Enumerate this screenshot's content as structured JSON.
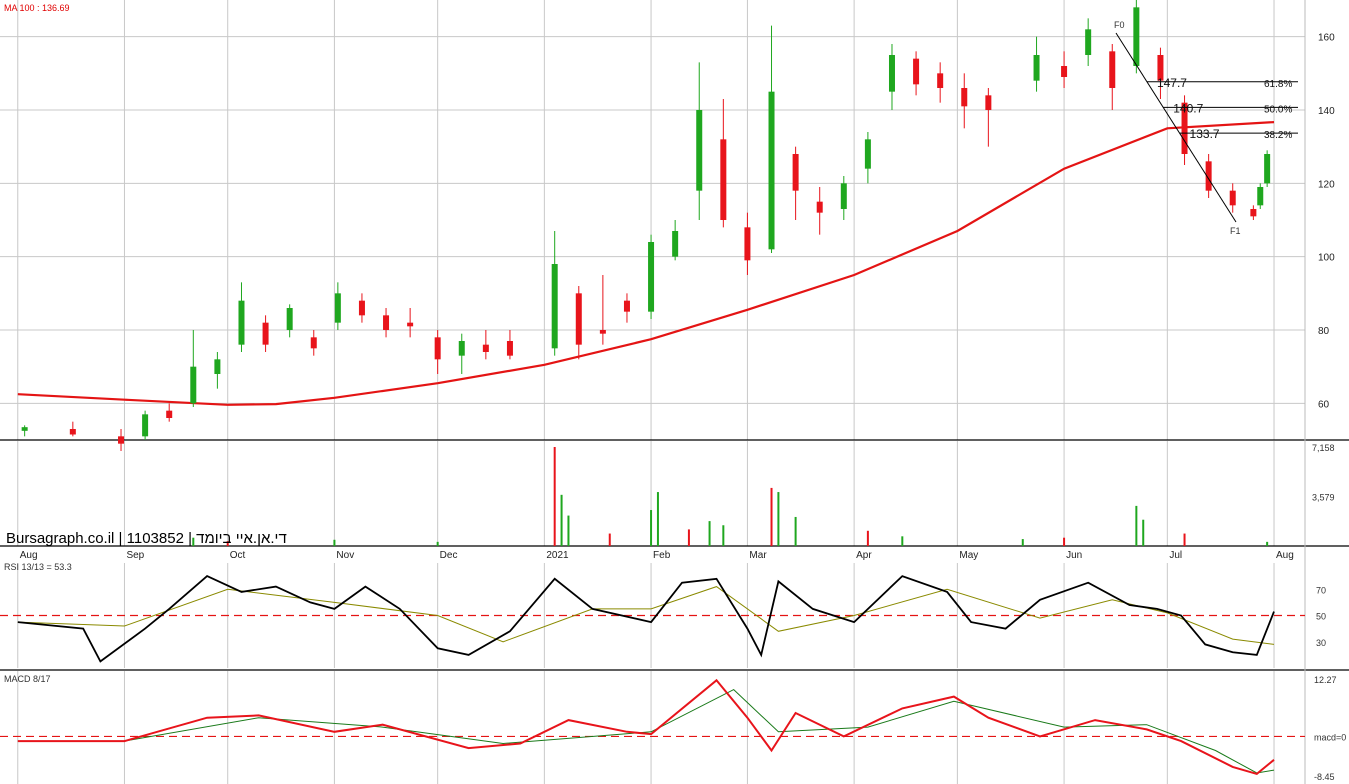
{
  "chart_data": {
    "type": "candlestick",
    "title": "",
    "watermark": "Bursagraph.co.il | 1103852 | די.אן.איי ביומד",
    "colors": {
      "up": "#1fa71f",
      "down": "#e8141b",
      "ma": "#e41414",
      "rsi": "#000000",
      "rsi_signal": "#8a8a00",
      "macd": "#e8141b",
      "macd_signal": "#1a7a1a"
    },
    "price_panel": {
      "ylim": [
        50,
        170
      ],
      "y_ticks": [
        60,
        80,
        100,
        120,
        140,
        160
      ],
      "ma_label": "MA 100 : 136.69",
      "ma_100": [
        {
          "x": "Aug 1",
          "y": 62.5
        },
        {
          "x": "Sep 1",
          "y": 61
        },
        {
          "x": "Oct 1",
          "y": 59.6
        },
        {
          "x": "Oct 15",
          "y": 59.8
        },
        {
          "x": "Nov 1",
          "y": 61.5
        },
        {
          "x": "Dec 1",
          "y": 65.5
        },
        {
          "x": "Jan 1",
          "y": 70.5
        },
        {
          "x": "Feb 1",
          "y": 77.5
        },
        {
          "x": "Mar 1",
          "y": 85.5
        },
        {
          "x": "Apr 1",
          "y": 95
        },
        {
          "x": "May 1",
          "y": 107
        },
        {
          "x": "Jun 1",
          "y": 124
        },
        {
          "x": "Jul 1",
          "y": 135
        },
        {
          "x": "Aug 1",
          "y": 136.7
        }
      ],
      "candles": [
        {
          "x": "Aug 3",
          "o": 52.5,
          "h": 54,
          "l": 51,
          "c": 53.5
        },
        {
          "x": "Aug 17",
          "o": 53,
          "h": 55,
          "l": 51,
          "c": 51.5
        },
        {
          "x": "Aug 31",
          "o": 51,
          "h": 53,
          "l": 47,
          "c": 49
        },
        {
          "x": "Sep 7",
          "o": 51,
          "h": 58,
          "l": 50,
          "c": 57
        },
        {
          "x": "Sep 14",
          "o": 58,
          "h": 60,
          "l": 55,
          "c": 56
        },
        {
          "x": "Sep 21",
          "o": 60,
          "h": 80,
          "l": 59,
          "c": 70
        },
        {
          "x": "Sep 28",
          "o": 68,
          "h": 74,
          "l": 64,
          "c": 72
        },
        {
          "x": "Oct 5",
          "o": 76,
          "h": 93,
          "l": 74,
          "c": 88
        },
        {
          "x": "Oct 12",
          "o": 82,
          "h": 84,
          "l": 74,
          "c": 76
        },
        {
          "x": "Oct 19",
          "o": 80,
          "h": 87,
          "l": 78,
          "c": 86
        },
        {
          "x": "Oct 26",
          "o": 78,
          "h": 80,
          "l": 73,
          "c": 75
        },
        {
          "x": "Nov 2",
          "o": 82,
          "h": 93,
          "l": 80,
          "c": 90
        },
        {
          "x": "Nov 9",
          "o": 88,
          "h": 90,
          "l": 82,
          "c": 84
        },
        {
          "x": "Nov 16",
          "o": 84,
          "h": 86,
          "l": 78,
          "c": 80
        },
        {
          "x": "Nov 23",
          "o": 82,
          "h": 86,
          "l": 78,
          "c": 81
        },
        {
          "x": "Dec 1",
          "o": 78,
          "h": 80,
          "l": 68,
          "c": 72
        },
        {
          "x": "Dec 8",
          "o": 73,
          "h": 79,
          "l": 68,
          "c": 77
        },
        {
          "x": "Dec 15",
          "o": 76,
          "h": 80,
          "l": 72,
          "c": 74
        },
        {
          "x": "Dec 22",
          "o": 77,
          "h": 80,
          "l": 72,
          "c": 73
        },
        {
          "x": "Jan 4",
          "o": 75,
          "h": 107,
          "l": 73,
          "c": 98
        },
        {
          "x": "Jan 11",
          "o": 90,
          "h": 92,
          "l": 72,
          "c": 76
        },
        {
          "x": "Jan 18",
          "o": 80,
          "h": 95,
          "l": 76,
          "c": 79
        },
        {
          "x": "Jan 25",
          "o": 88,
          "h": 90,
          "l": 82,
          "c": 85
        },
        {
          "x": "Feb 1",
          "o": 85,
          "h": 106,
          "l": 83,
          "c": 104
        },
        {
          "x": "Feb 8",
          "o": 100,
          "h": 110,
          "l": 99,
          "c": 107
        },
        {
          "x": "Feb 15",
          "o": 118,
          "h": 153,
          "l": 110,
          "c": 140
        },
        {
          "x": "Feb 22",
          "o": 132,
          "h": 143,
          "l": 108,
          "c": 110
        },
        {
          "x": "Mar 1",
          "o": 108,
          "h": 112,
          "l": 95,
          "c": 99
        },
        {
          "x": "Mar 8",
          "o": 102,
          "h": 163,
          "l": 101,
          "c": 145
        },
        {
          "x": "Mar 15",
          "o": 128,
          "h": 130,
          "l": 110,
          "c": 118
        },
        {
          "x": "Mar 22",
          "o": 115,
          "h": 119,
          "l": 106,
          "c": 112
        },
        {
          "x": "Mar 29",
          "o": 113,
          "h": 122,
          "l": 110,
          "c": 120
        },
        {
          "x": "Apr 5",
          "o": 124,
          "h": 134,
          "l": 120,
          "c": 132
        },
        {
          "x": "Apr 12",
          "o": 145,
          "h": 158,
          "l": 140,
          "c": 155
        },
        {
          "x": "Apr 19",
          "o": 154,
          "h": 156,
          "l": 144,
          "c": 147
        },
        {
          "x": "Apr 26",
          "o": 150,
          "h": 153,
          "l": 142,
          "c": 146
        },
        {
          "x": "May 3",
          "o": 146,
          "h": 150,
          "l": 135,
          "c": 141
        },
        {
          "x": "May 10",
          "o": 144,
          "h": 146,
          "l": 130,
          "c": 140
        },
        {
          "x": "May 24",
          "o": 148,
          "h": 160,
          "l": 145,
          "c": 155
        },
        {
          "x": "Jun 1",
          "o": 152,
          "h": 156,
          "l": 146,
          "c": 149
        },
        {
          "x": "Jun 8",
          "o": 155,
          "h": 165,
          "l": 152,
          "c": 162
        },
        {
          "x": "Jun 15",
          "o": 156,
          "h": 158,
          "l": 140,
          "c": 146
        },
        {
          "x": "Jun 22",
          "o": 152,
          "h": 170,
          "l": 150,
          "c": 168
        },
        {
          "x": "Jun 29",
          "o": 155,
          "h": 157,
          "l": 143,
          "c": 148
        },
        {
          "x": "Jul 6",
          "o": 142,
          "h": 144,
          "l": 125,
          "c": 128
        },
        {
          "x": "Jul 13",
          "o": 126,
          "h": 128,
          "l": 116,
          "c": 118
        },
        {
          "x": "Jul 20",
          "o": 118,
          "h": 120,
          "l": 112,
          "c": 114
        },
        {
          "x": "Jul 26",
          "o": 113,
          "h": 114,
          "l": 110,
          "c": 111
        },
        {
          "x": "Jul 28",
          "o": 114,
          "h": 120,
          "l": 113,
          "c": 119
        },
        {
          "x": "Jul 30",
          "o": 120,
          "h": 129,
          "l": 119,
          "c": 128
        }
      ],
      "fibonacci": {
        "start_label": "F0",
        "end_label": "F1",
        "levels": [
          {
            "value": "147.7",
            "pct": "61.8%"
          },
          {
            "value": "140.7",
            "pct": "50.0%"
          },
          {
            "value": "133.7",
            "pct": "38.2%"
          }
        ]
      }
    },
    "volume_panel": {
      "y_ticks": [
        "7,158",
        "3,579"
      ],
      "ymax": 7158,
      "bars": [
        {
          "x": "Sep 21",
          "v": 600
        },
        {
          "x": "Oct 1",
          "v": 350
        },
        {
          "x": "Nov 1",
          "v": 450
        },
        {
          "x": "Dec 1",
          "v": 300
        },
        {
          "x": "Jan 4",
          "v": 7158
        },
        {
          "x": "Jan 6",
          "v": 3700
        },
        {
          "x": "Jan 8",
          "v": 2200
        },
        {
          "x": "Jan 20",
          "v": 900
        },
        {
          "x": "Feb 1",
          "v": 2600
        },
        {
          "x": "Feb 3",
          "v": 3900
        },
        {
          "x": "Feb 12",
          "v": 1200
        },
        {
          "x": "Feb 18",
          "v": 1800
        },
        {
          "x": "Feb 22",
          "v": 1500
        },
        {
          "x": "Mar 8",
          "v": 4200
        },
        {
          "x": "Mar 10",
          "v": 3900
        },
        {
          "x": "Mar 15",
          "v": 2100
        },
        {
          "x": "Apr 5",
          "v": 1100
        },
        {
          "x": "Apr 15",
          "v": 700
        },
        {
          "x": "May 20",
          "v": 500
        },
        {
          "x": "Jun 1",
          "v": 600
        },
        {
          "x": "Jun 22",
          "v": 2900
        },
        {
          "x": "Jun 24",
          "v": 1900
        },
        {
          "x": "Jul 6",
          "v": 900
        },
        {
          "x": "Jul 30",
          "v": 300
        }
      ]
    },
    "x_axis": {
      "labels": [
        "Aug",
        "Sep",
        "Oct",
        "Nov",
        "Dec",
        "2021",
        "Feb",
        "Mar",
        "Apr",
        "May",
        "Jun",
        "Jul",
        "Aug"
      ]
    },
    "rsi_panel": {
      "label": "RSI 13/13 = 53.3",
      "ylim": [
        10,
        90
      ],
      "y_ticks": [
        30,
        50,
        70
      ],
      "ref_line": 50,
      "rsi": [
        {
          "x": "Aug 1",
          "y": 45
        },
        {
          "x": "Aug 20",
          "y": 40
        },
        {
          "x": "Aug 25",
          "y": 15
        },
        {
          "x": "Sep 7",
          "y": 40
        },
        {
          "x": "Sep 14",
          "y": 55
        },
        {
          "x": "Sep 25",
          "y": 80
        },
        {
          "x": "Oct 5",
          "y": 68
        },
        {
          "x": "Oct 15",
          "y": 72
        },
        {
          "x": "Oct 25",
          "y": 60
        },
        {
          "x": "Nov 1",
          "y": 55
        },
        {
          "x": "Nov 10",
          "y": 72
        },
        {
          "x": "Nov 20",
          "y": 55
        },
        {
          "x": "Dec 1",
          "y": 25
        },
        {
          "x": "Dec 10",
          "y": 20
        },
        {
          "x": "Dec 22",
          "y": 38
        },
        {
          "x": "Jan 4",
          "y": 78
        },
        {
          "x": "Jan 15",
          "y": 55
        },
        {
          "x": "Feb 1",
          "y": 45
        },
        {
          "x": "Feb 10",
          "y": 75
        },
        {
          "x": "Feb 20",
          "y": 78
        },
        {
          "x": "Mar 1",
          "y": 40
        },
        {
          "x": "Mar 5",
          "y": 20
        },
        {
          "x": "Mar 10",
          "y": 76
        },
        {
          "x": "Mar 20",
          "y": 55
        },
        {
          "x": "Apr 1",
          "y": 45
        },
        {
          "x": "Apr 15",
          "y": 80
        },
        {
          "x": "Apr 28",
          "y": 68
        },
        {
          "x": "May 5",
          "y": 45
        },
        {
          "x": "May 15",
          "y": 40
        },
        {
          "x": "May 25",
          "y": 62
        },
        {
          "x": "Jun 8",
          "y": 75
        },
        {
          "x": "Jun 20",
          "y": 58
        },
        {
          "x": "Jun 28",
          "y": 55
        },
        {
          "x": "Jul 5",
          "y": 50
        },
        {
          "x": "Jul 12",
          "y": 28
        },
        {
          "x": "Jul 20",
          "y": 22
        },
        {
          "x": "Jul 27",
          "y": 20
        },
        {
          "x": "Aug 1",
          "y": 53
        }
      ],
      "signal": [
        {
          "x": "Aug 1",
          "y": 45
        },
        {
          "x": "Sep 1",
          "y": 42
        },
        {
          "x": "Oct 1",
          "y": 70
        },
        {
          "x": "Nov 1",
          "y": 60
        },
        {
          "x": "Dec 1",
          "y": 50
        },
        {
          "x": "Dec 20",
          "y": 30
        },
        {
          "x": "Jan 15",
          "y": 55
        },
        {
          "x": "Feb 1",
          "y": 55
        },
        {
          "x": "Feb 20",
          "y": 72
        },
        {
          "x": "Mar 10",
          "y": 38
        },
        {
          "x": "Apr 1",
          "y": 50
        },
        {
          "x": "Apr 28",
          "y": 70
        },
        {
          "x": "May 25",
          "y": 48
        },
        {
          "x": "Jun 15",
          "y": 62
        },
        {
          "x": "Jul 1",
          "y": 52
        },
        {
          "x": "Jul 20",
          "y": 32
        },
        {
          "x": "Aug 1",
          "y": 28
        }
      ]
    },
    "macd_panel": {
      "label": "MACD 8/17",
      "ylim": [
        -8.45,
        12.27
      ],
      "y_ticks": [
        "12.27",
        "macd=0",
        "-8.45"
      ],
      "macd": [
        {
          "x": "Aug 1",
          "y": -1
        },
        {
          "x": "Sep 1",
          "y": -1
        },
        {
          "x": "Sep 25",
          "y": 4
        },
        {
          "x": "Oct 10",
          "y": 4.5
        },
        {
          "x": "Nov 1",
          "y": 1
        },
        {
          "x": "Nov 15",
          "y": 2.5
        },
        {
          "x": "Dec 10",
          "y": -2.5
        },
        {
          "x": "Dec 25",
          "y": -1.5
        },
        {
          "x": "Jan 8",
          "y": 3.5
        },
        {
          "x": "Jan 25",
          "y": 1
        },
        {
          "x": "Feb 1",
          "y": 0.5
        },
        {
          "x": "Feb 20",
          "y": 12
        },
        {
          "x": "Mar 1",
          "y": 4
        },
        {
          "x": "Mar 8",
          "y": -3
        },
        {
          "x": "Mar 15",
          "y": 5
        },
        {
          "x": "Mar 29",
          "y": 0
        },
        {
          "x": "Apr 15",
          "y": 6
        },
        {
          "x": "Apr 30",
          "y": 8.5
        },
        {
          "x": "May 10",
          "y": 4
        },
        {
          "x": "May 25",
          "y": 0
        },
        {
          "x": "Jun 10",
          "y": 3.5
        },
        {
          "x": "Jun 25",
          "y": 1.5
        },
        {
          "x": "Jul 5",
          "y": -1
        },
        {
          "x": "Jul 20",
          "y": -6.5
        },
        {
          "x": "Jul 27",
          "y": -8
        },
        {
          "x": "Aug 1",
          "y": -5
        }
      ],
      "signal": [
        {
          "x": "Aug 1",
          "y": -1
        },
        {
          "x": "Sep 1",
          "y": -1
        },
        {
          "x": "Oct 10",
          "y": 4
        },
        {
          "x": "Nov 15",
          "y": 2
        },
        {
          "x": "Dec 20",
          "y": -1.5
        },
        {
          "x": "Feb 1",
          "y": 1
        },
        {
          "x": "Feb 25",
          "y": 10
        },
        {
          "x": "Mar 10",
          "y": 1
        },
        {
          "x": "Apr 5",
          "y": 2
        },
        {
          "x": "Apr 30",
          "y": 7.5
        },
        {
          "x": "Jun 1",
          "y": 2
        },
        {
          "x": "Jun 25",
          "y": 2.5
        },
        {
          "x": "Jul 15",
          "y": -3
        },
        {
          "x": "Jul 27",
          "y": -7.8
        },
        {
          "x": "Aug 1",
          "y": -7.2
        }
      ]
    }
  }
}
